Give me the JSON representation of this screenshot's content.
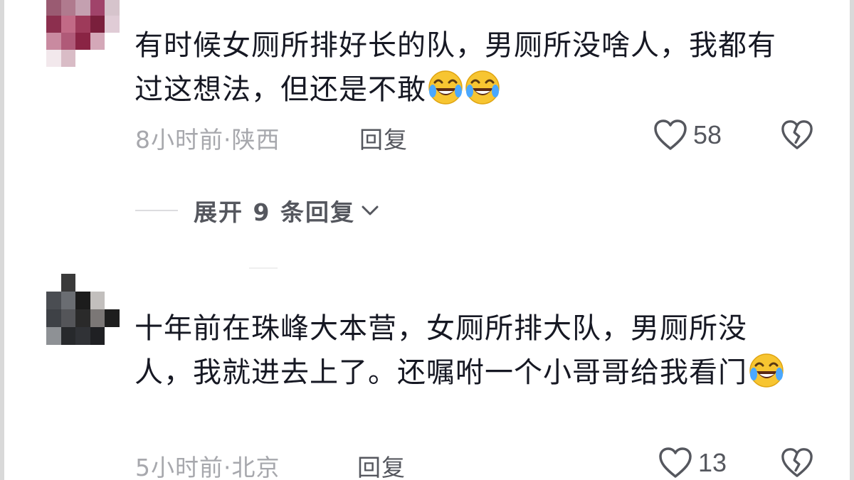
{
  "comments": [
    {
      "text": "有时候女厕所排好长的队，男厕所没啥人，我都有过这想法，但还是不敢",
      "emojis": [
        "laughing-tears-emoji",
        "laughing-tears-emoji"
      ],
      "time_location": "8小时前·陕西",
      "reply_label": "回复",
      "likes": "58",
      "avatar_colors": [
        "#9a5b72",
        "#b07a8e",
        "#c4a0b0",
        "#a0436a",
        "#d6c4cc",
        "#8c2f4e",
        "#c26a86",
        "#9e3a5a",
        "#7a1f3c",
        "#e0ccd6",
        "#c98aa0",
        "#b05a78",
        "#8a2444",
        "#d4a8b8",
        "#ffffff",
        "#f2e8ec",
        "#d9bcc6",
        "#ffffff",
        "#ffffff",
        "#ffffff"
      ],
      "expand_label": "展开 9 条回复"
    },
    {
      "text": "十年前在珠峰大本营，女厕所排大队，男厕所没人，我就进去上了。还嘱咐一个小哥哥给我看门",
      "emojis": [
        "laughing-tears-emoji"
      ],
      "time_location": "5小时前·北京",
      "reply_label": "回复",
      "likes": "13",
      "avatar_colors": [
        "#ffffff",
        "#3a3a3a",
        "#ffffff",
        "#ffffff",
        "#ffffff",
        "#4a4d52",
        "#6a6d72",
        "#1c1c1c",
        "#c2bfbd",
        "#ffffff",
        "#3e4146",
        "#545559",
        "#2a2a2a",
        "#7b7776",
        "#1e1e1e",
        "#8e9195",
        "#27292c",
        "#303236",
        "#1f2023",
        "#ffffff"
      ]
    }
  ],
  "colors": {
    "text": "#161823",
    "meta": "#a7a8ad",
    "action": "#55575e"
  }
}
